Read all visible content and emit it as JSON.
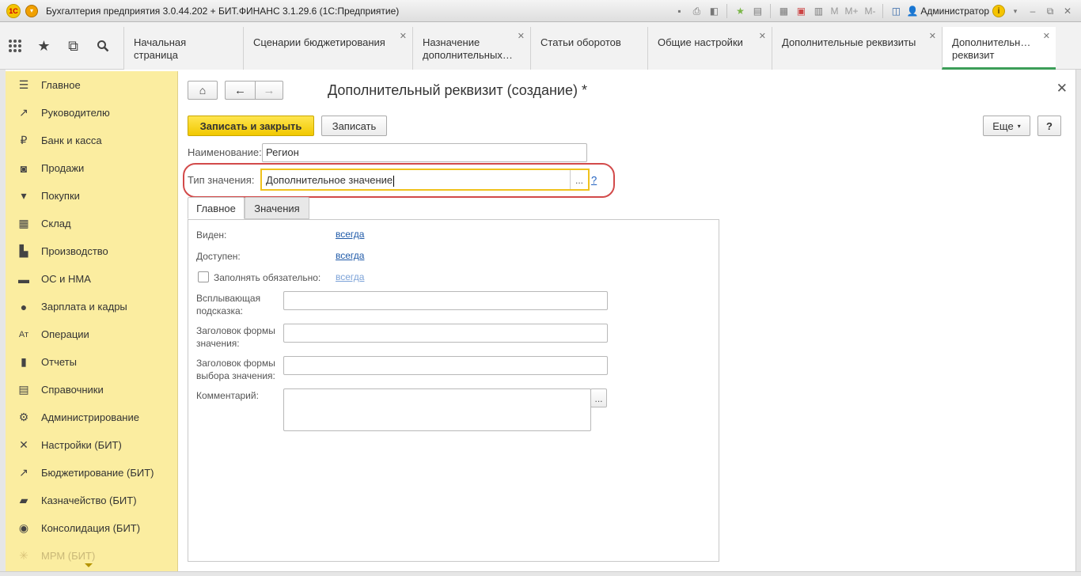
{
  "titlebar": {
    "logo": "1С",
    "title": "Бухгалтерия предприятия 3.0.44.202 + БИТ.ФИНАНС 3.1.29.6  (1С:Предприятие)",
    "m_labels": [
      "M",
      "M+",
      "M-"
    ],
    "user": "Администратор",
    "info": "i"
  },
  "tabs": [
    {
      "label": "Начальная страница",
      "closable": false
    },
    {
      "label": "Сценарии бюджетирования",
      "closable": true
    },
    {
      "label": "Назначение дополнительных…",
      "closable": true
    },
    {
      "label": "Статьи оборотов",
      "closable": false
    },
    {
      "label": "Общие настройки",
      "closable": true
    },
    {
      "label": "Дополнительные реквизиты",
      "closable": true
    },
    {
      "label": "Дополнительн… реквизит",
      "closable": true,
      "active": true
    }
  ],
  "sidebar": {
    "items": [
      {
        "label": "Главное",
        "icon": "menu-icon"
      },
      {
        "label": "Руководителю",
        "icon": "trend-icon"
      },
      {
        "label": "Банк и касса",
        "icon": "ruble-icon"
      },
      {
        "label": "Продажи",
        "icon": "bag-icon"
      },
      {
        "label": "Покупки",
        "icon": "cart-icon"
      },
      {
        "label": "Склад",
        "icon": "warehouse-icon"
      },
      {
        "label": "Производство",
        "icon": "factory-icon"
      },
      {
        "label": "ОС и НМА",
        "icon": "truck-icon"
      },
      {
        "label": "Зарплата и кадры",
        "icon": "person-icon"
      },
      {
        "label": "Операции",
        "icon": "operations-icon"
      },
      {
        "label": "Отчеты",
        "icon": "bar-chart-icon"
      },
      {
        "label": "Справочники",
        "icon": "books-icon"
      },
      {
        "label": "Администрирование",
        "icon": "gear-icon"
      },
      {
        "label": "Настройки (БИТ)",
        "icon": "tools-icon"
      },
      {
        "label": "Бюджетирование (БИТ)",
        "icon": "growth-icon"
      },
      {
        "label": "Казначейство (БИТ)",
        "icon": "money-icon"
      },
      {
        "label": "Консолидация (БИТ)",
        "icon": "globe-icon"
      },
      {
        "label": "МРМ (БИТ)",
        "icon": "sun-icon"
      }
    ]
  },
  "form": {
    "title": "Дополнительный реквизит (создание) *",
    "save_close": "Записать и закрыть",
    "save": "Записать",
    "more": "Еще",
    "help": "?",
    "name_label": "Наименование:",
    "name_value": "Регион",
    "type_label": "Тип значения:",
    "type_value": "Дополнительное значение",
    "type_help": "?",
    "dots": "...",
    "tabs": [
      "Главное",
      "Значения"
    ],
    "visible_label": "Виден:",
    "visible_value": "всегда",
    "enabled_label": "Доступен:",
    "enabled_value": "всегда",
    "required_label": "Заполнять обязательно:",
    "required_value": "всегда",
    "tooltip_label": "Всплывающая подсказка:",
    "value_form_label": "Заголовок формы значения:",
    "choice_form_label": "Заголовок формы выбора значения:",
    "comment_label": "Комментарий:"
  }
}
